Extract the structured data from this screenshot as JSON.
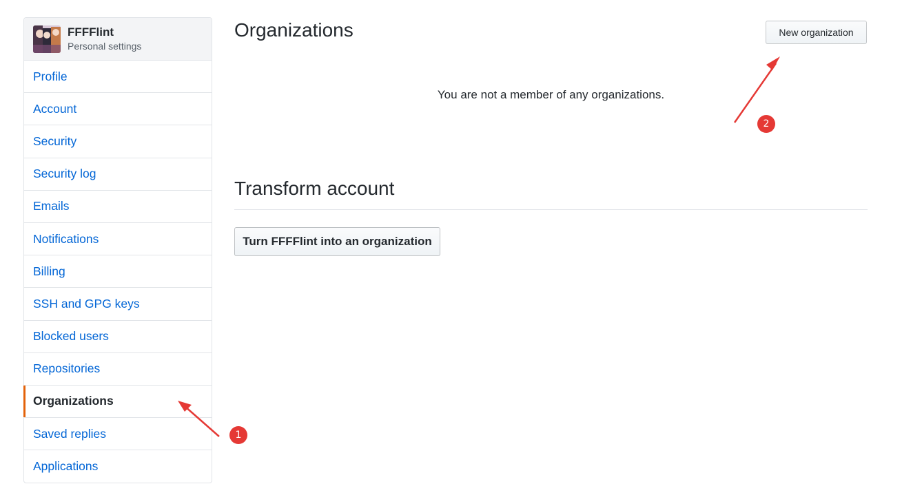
{
  "sidebar": {
    "user_name": "FFFFlint",
    "user_subtitle": "Personal settings",
    "items": [
      {
        "label": "Profile"
      },
      {
        "label": "Account"
      },
      {
        "label": "Security"
      },
      {
        "label": "Security log"
      },
      {
        "label": "Emails"
      },
      {
        "label": "Notifications"
      },
      {
        "label": "Billing"
      },
      {
        "label": "SSH and GPG keys"
      },
      {
        "label": "Blocked users"
      },
      {
        "label": "Repositories"
      },
      {
        "label": "Organizations",
        "selected": true
      },
      {
        "label": "Saved replies"
      },
      {
        "label": "Applications"
      }
    ]
  },
  "main": {
    "title": "Organizations",
    "new_org_button": "New organization",
    "empty_message": "You are not a member of any organizations.",
    "transform": {
      "title": "Transform account",
      "button": "Turn FFFFlint into an organization"
    }
  },
  "annotations": {
    "badge1": "1",
    "badge2": "2",
    "color": "#e53935"
  },
  "colors": {
    "link": "#0366d6",
    "selected_accent": "#e36209"
  }
}
